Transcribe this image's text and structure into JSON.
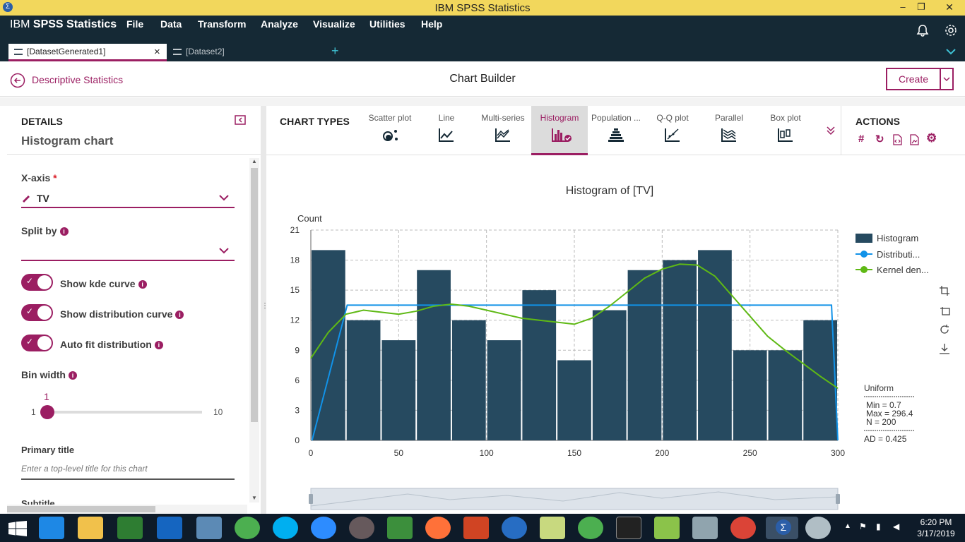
{
  "window": {
    "title": "IBM SPSS Statistics",
    "min": "–",
    "max": "❐",
    "close": "✕"
  },
  "menubar": {
    "brand_light": "IBM",
    "brand_bold": "SPSS Statistics",
    "items": [
      "File",
      "Data",
      "Transform",
      "Analyze",
      "Visualize",
      "Utilities",
      "Help"
    ]
  },
  "tabs": [
    {
      "label": "[DatasetGenerated1]",
      "active": true
    },
    {
      "label": "[Dataset2]",
      "active": false
    }
  ],
  "tabs_close": "×",
  "tabs_add": "+",
  "subheader": {
    "back_label": "Descriptive Statistics",
    "title": "Chart Builder",
    "create_label": "Create"
  },
  "details": {
    "heading": "DETAILS",
    "subheading": "Histogram chart",
    "xaxis_label": "X-axis",
    "xaxis_required": "*",
    "xaxis_value": "TV",
    "split_label": "Split by",
    "split_value": "",
    "toggles": [
      {
        "label": "Show kde curve",
        "on": true
      },
      {
        "label": "Show distribution curve",
        "on": true
      },
      {
        "label": "Auto fit distribution",
        "on": true
      }
    ],
    "bin_label": "Bin width",
    "bin_value": "1",
    "bin_min": "1",
    "bin_max": "10",
    "primary_title_label": "Primary title",
    "primary_title_placeholder": "Enter a top-level title for this chart",
    "subtitle_label": "Subtitle"
  },
  "chart_types": {
    "heading": "CHART TYPES",
    "items": [
      "Scatter plot",
      "Line",
      "Multi-series",
      "Histogram",
      "Population ...",
      "Q-Q plot",
      "Parallel",
      "Box plot"
    ],
    "selected": "Histogram"
  },
  "actions": {
    "heading": "ACTIONS",
    "icons": [
      "hash-icon",
      "refresh-icon",
      "code-icon",
      "image-icon",
      "settings-icon"
    ]
  },
  "chart_data": {
    "type": "bar",
    "title": "Histogram of [TV]",
    "ylabel": "Count",
    "xlabel": "",
    "ylim": [
      0,
      21
    ],
    "xlim": [
      0,
      300
    ],
    "yticks": [
      0,
      3,
      6,
      9,
      12,
      15,
      18,
      21
    ],
    "xticks": [
      0,
      50,
      100,
      150,
      200,
      250,
      300
    ],
    "grid": true,
    "bins": [
      {
        "x0": 0,
        "x1": 20,
        "count": 19
      },
      {
        "x0": 20,
        "x1": 40,
        "count": 12
      },
      {
        "x0": 40,
        "x1": 60,
        "count": 10
      },
      {
        "x0": 60,
        "x1": 80,
        "count": 17
      },
      {
        "x0": 80,
        "x1": 100,
        "count": 12
      },
      {
        "x0": 100,
        "x1": 120,
        "count": 10
      },
      {
        "x0": 120,
        "x1": 140,
        "count": 15
      },
      {
        "x0": 140,
        "x1": 160,
        "count": 8
      },
      {
        "x0": 160,
        "x1": 180,
        "count": 13
      },
      {
        "x0": 180,
        "x1": 200,
        "count": 17
      },
      {
        "x0": 200,
        "x1": 220,
        "count": 18
      },
      {
        "x0": 220,
        "x1": 240,
        "count": 19
      },
      {
        "x0": 240,
        "x1": 260,
        "count": 9
      },
      {
        "x0": 260,
        "x1": 280,
        "count": 9
      },
      {
        "x0": 280,
        "x1": 300,
        "count": 12
      }
    ],
    "distribution_curve": [
      [
        0.7,
        0
      ],
      [
        20.7,
        13.5
      ],
      [
        296.4,
        13.5
      ],
      [
        300,
        0
      ]
    ],
    "kde_curve": [
      [
        0,
        8.2
      ],
      [
        10,
        10.8
      ],
      [
        20,
        12.6
      ],
      [
        30,
        13
      ],
      [
        40,
        12.8
      ],
      [
        50,
        12.6
      ],
      [
        60,
        12.9
      ],
      [
        70,
        13.4
      ],
      [
        80,
        13.6
      ],
      [
        90,
        13.4
      ],
      [
        100,
        13
      ],
      [
        110,
        12.6
      ],
      [
        120,
        12.2
      ],
      [
        130,
        12
      ],
      [
        140,
        11.8
      ],
      [
        150,
        11.6
      ],
      [
        160,
        12.2
      ],
      [
        170,
        13.4
      ],
      [
        180,
        14.8
      ],
      [
        190,
        16.2
      ],
      [
        200,
        17.1
      ],
      [
        210,
        17.6
      ],
      [
        220,
        17.5
      ],
      [
        230,
        16.4
      ],
      [
        240,
        14.4
      ],
      [
        250,
        12.4
      ],
      [
        260,
        10.4
      ],
      [
        270,
        9
      ],
      [
        280,
        7.7
      ],
      [
        290,
        6.4
      ],
      [
        300,
        5.2
      ]
    ],
    "colors": {
      "bar": "#264a60",
      "distribution": "#1192e8",
      "kde": "#5fb915"
    },
    "legend": {
      "placement": "right",
      "items": [
        {
          "name": "Histogram",
          "color": "#264a60"
        },
        {
          "name": "Distributi...",
          "color": "#1192e8"
        },
        {
          "name": "Kernel den...",
          "color": "#5fb915"
        }
      ]
    },
    "stats": {
      "heading": "Uniform",
      "min": "Min = 0.7",
      "max": "Max = 296.4",
      "n": "N = 200",
      "ad": "AD = 0.425"
    }
  },
  "taskbar": {
    "time": "6:20 PM",
    "date": "3/17/2019"
  }
}
